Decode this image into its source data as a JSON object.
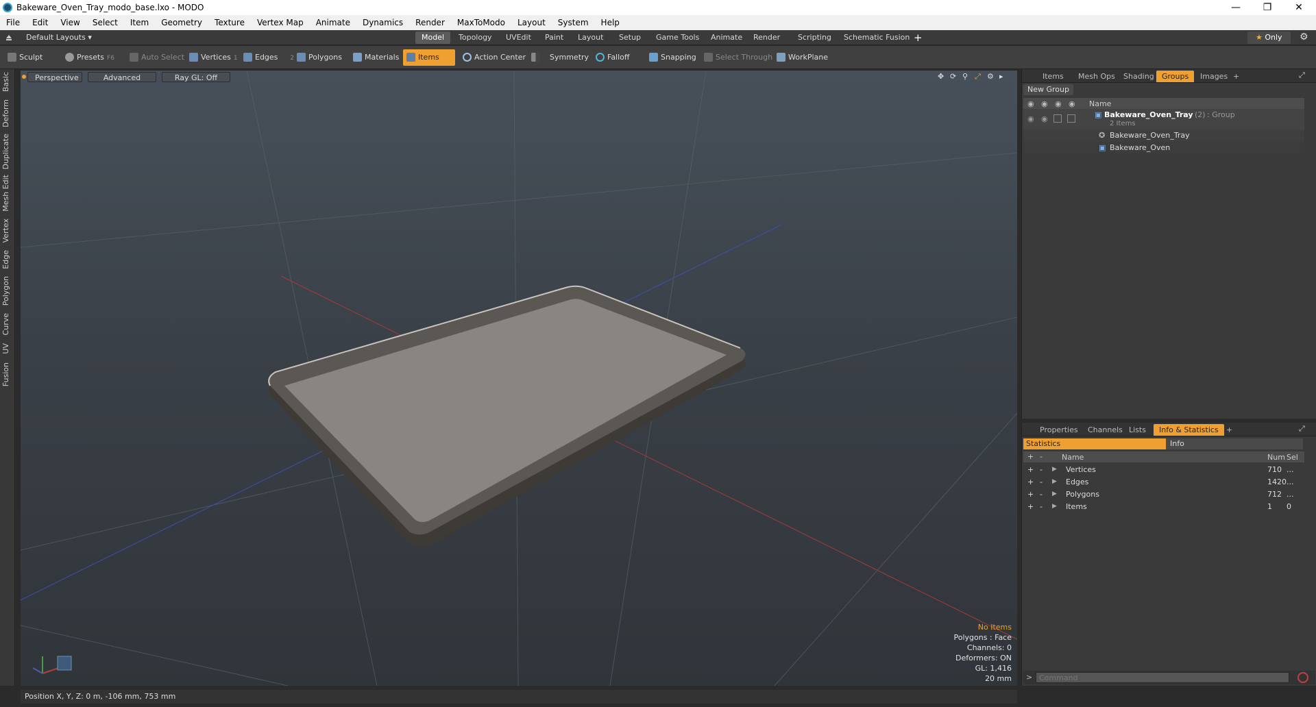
{
  "window": {
    "title": "Bakeware_Oven_Tray_modo_base.lxo - MODO"
  },
  "menu": [
    "File",
    "Edit",
    "View",
    "Select",
    "Item",
    "Geometry",
    "Texture",
    "Vertex Map",
    "Animate",
    "Dynamics",
    "Render",
    "MaxToModo",
    "Layout",
    "System",
    "Help"
  ],
  "layoutbar": {
    "layouts_label": "Default Layouts",
    "tabs": [
      "Model",
      "Topology",
      "UVEdit",
      "Paint",
      "Layout",
      "Setup",
      "Game Tools",
      "Animate",
      "Render",
      "Scripting",
      "Schematic Fusion"
    ],
    "active_tab": "Model",
    "only_label": "Only"
  },
  "toolbar": {
    "sculpt": "Sculpt",
    "presets": "Presets",
    "presets_key": "F6",
    "auto_select": "Auto Select",
    "vertices": "Vertices",
    "vertices_key": "1",
    "edges": "Edges",
    "edges_key": "2",
    "polygons": "Polygons",
    "materials": "Materials",
    "items": "Items",
    "action_center": "Action Center",
    "symmetry": "Symmetry",
    "falloff": "Falloff",
    "snapping": "Snapping",
    "select_through": "Select Through",
    "workplane": "WorkPlane"
  },
  "lefttabs": [
    "Basic",
    "Deform",
    "Duplicate",
    "Mesh Edit",
    "Vertex",
    "Edge",
    "Polygon",
    "Curve",
    "UV",
    "Fusion"
  ],
  "viewport": {
    "perspective": "Perspective",
    "advanced": "Advanced",
    "raygl": "Ray GL: Off",
    "hud": {
      "no_items": "No Items",
      "polygons": "Polygons : Face",
      "channels": "Channels: 0",
      "deformers": "Deformers: ON",
      "gl": "GL: 1,416",
      "scale": "20 mm"
    }
  },
  "statusbar": {
    "position": "Position X, Y, Z:  0 m, -106 mm, 753 mm"
  },
  "groups_panel": {
    "tabs": [
      "Items",
      "Mesh Ops",
      "Shading",
      "Groups",
      "Images"
    ],
    "active_tab": "Groups",
    "new_group": "New Group",
    "col_name": "Name",
    "group_name": "Bakeware_Oven_Tray",
    "group_count": "(2)",
    "group_type": ": Group",
    "group_sub": "2 Items",
    "children": [
      "Bakeware_Oven_Tray",
      "Bakeware_Oven"
    ]
  },
  "stats_panel": {
    "tabs": [
      "Properties",
      "Channels",
      "Lists",
      "Info & Statistics"
    ],
    "active_tab": "Info & Statistics",
    "sub_tabs": [
      "Statistics",
      "Info"
    ],
    "col_name": "Name",
    "col_num": "Num",
    "col_sel": "Sel",
    "rows": [
      {
        "name": "Vertices",
        "num": "710",
        "sel": "..."
      },
      {
        "name": "Edges",
        "num": "1420",
        "sel": "..."
      },
      {
        "name": "Polygons",
        "num": "712",
        "sel": "..."
      },
      {
        "name": "Items",
        "num": "1",
        "sel": "0"
      }
    ]
  },
  "command": {
    "placeholder": "Command"
  }
}
